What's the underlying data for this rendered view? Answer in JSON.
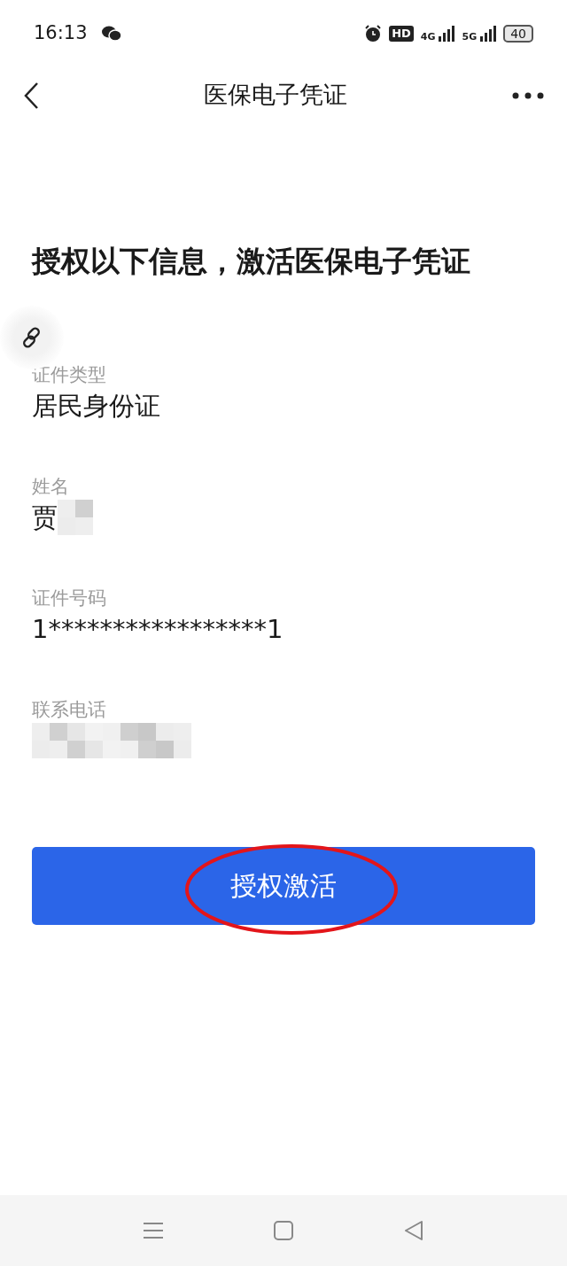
{
  "status_bar": {
    "time": "16:13",
    "hd_label": "HD",
    "networks": [
      "4G",
      "5G"
    ],
    "battery": "40"
  },
  "header": {
    "title": "医保电子凭证"
  },
  "heading": "授权以下信息，激活医保电子凭证",
  "fields": [
    {
      "label": "证件类型",
      "value": "居民身份证",
      "redacted": false
    },
    {
      "label": "姓名",
      "value": "贾",
      "redacted": true
    },
    {
      "label": "证件号码",
      "value": "1*****************1",
      "redacted": false
    },
    {
      "label": "联系电话",
      "redacted": true
    }
  ],
  "button": {
    "label": "授权激活",
    "circled": true
  }
}
